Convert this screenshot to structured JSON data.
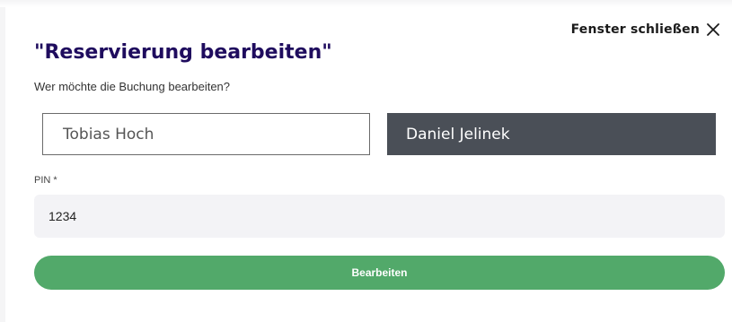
{
  "header": {
    "close_label": "Fenster schließen",
    "close_icon": "close-icon"
  },
  "dialog": {
    "title": "\"Reservierung bearbeiten\"",
    "subtitle": "Wer möchte die Buchung bearbeiten?",
    "choices": [
      {
        "label": "Tobias Hoch",
        "selected": false
      },
      {
        "label": "Daniel Jelinek",
        "selected": true
      }
    ],
    "pin": {
      "label": "PIN *",
      "value": "1234"
    },
    "submit_label": "Bearbeiten"
  },
  "colors": {
    "title": "#1f0c5e",
    "selected_choice_bg": "#4a4f57",
    "pin_field_bg": "#f3f3f6",
    "submit_bg": "#52a96a"
  }
}
